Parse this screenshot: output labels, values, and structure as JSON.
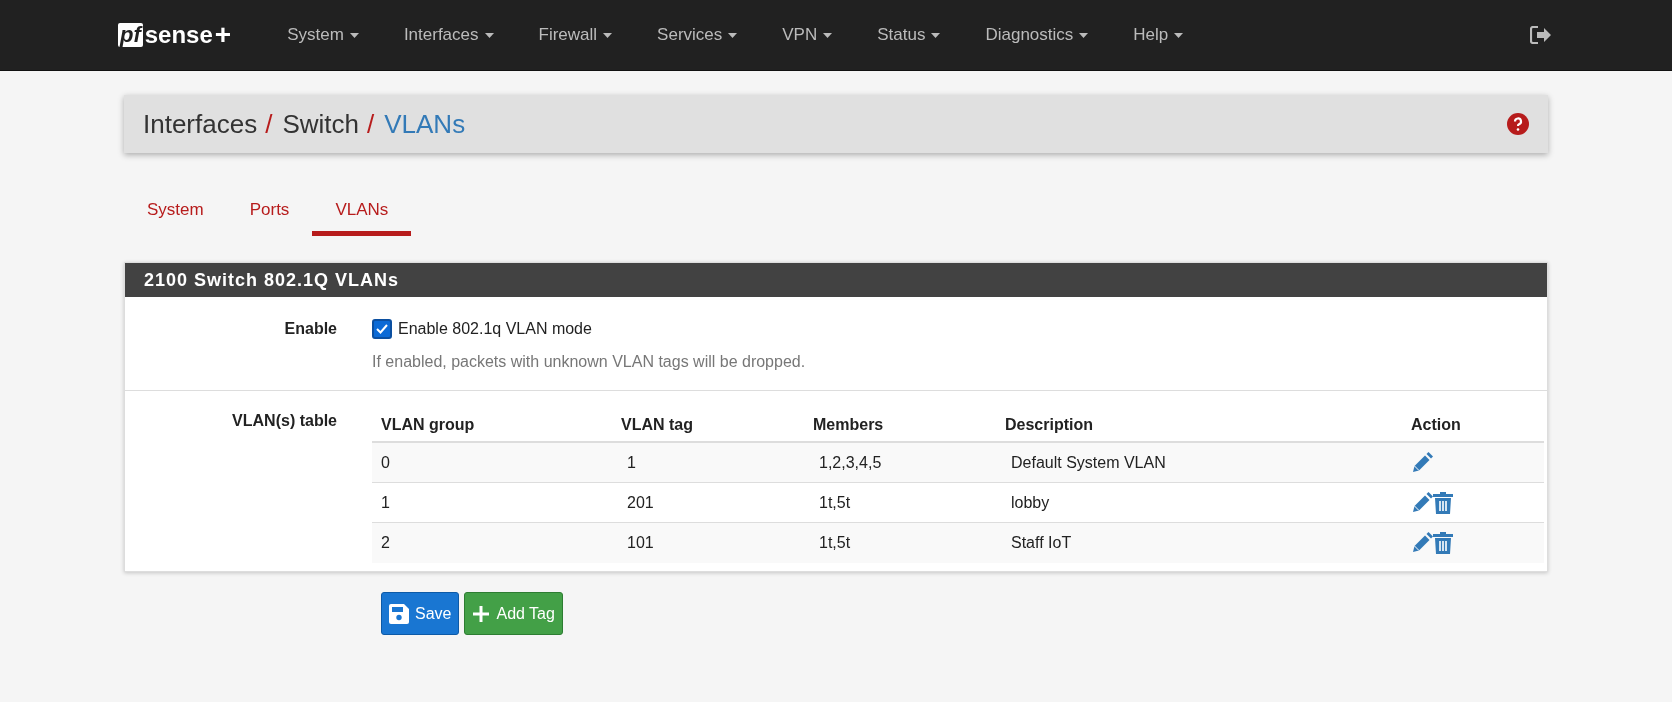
{
  "navbar": {
    "logo": {
      "box": "pf",
      "word": "sense",
      "plus": "+"
    },
    "menus": [
      {
        "label": "System"
      },
      {
        "label": "Interfaces"
      },
      {
        "label": "Firewall"
      },
      {
        "label": "Services"
      },
      {
        "label": "VPN"
      },
      {
        "label": "Status"
      },
      {
        "label": "Diagnostics"
      },
      {
        "label": "Help"
      }
    ]
  },
  "breadcrumb": {
    "items": [
      "Interfaces",
      "Switch",
      "VLANs"
    ],
    "separator": "/"
  },
  "tabs": [
    {
      "label": "System",
      "selected": false
    },
    {
      "label": "Ports",
      "selected": false
    },
    {
      "label": "VLANs",
      "selected": true
    }
  ],
  "panel": {
    "title": "2100 Switch 802.1Q VLANs",
    "enable": {
      "label": "Enable",
      "checkbox_label": "Enable 802.1q VLAN mode",
      "checked": true,
      "help": "If enabled, packets with unknown VLAN tags will be dropped."
    },
    "table": {
      "label": "VLAN(s) table",
      "columns": [
        "VLAN group",
        "VLAN tag",
        "Members",
        "Description",
        "Action"
      ],
      "rows": [
        {
          "cells": [
            "0",
            "1",
            "1,2,3,4,5",
            "Default System VLAN"
          ],
          "deletable": false
        },
        {
          "cells": [
            "1",
            "201",
            "1t,5t",
            "lobby"
          ],
          "deletable": true
        },
        {
          "cells": [
            "2",
            "101",
            "1t,5t",
            "Staff IoT"
          ],
          "deletable": true
        }
      ]
    }
  },
  "buttons": [
    {
      "kind": "save",
      "label": "Save"
    },
    {
      "kind": "add",
      "label": "Add Tag"
    }
  ]
}
